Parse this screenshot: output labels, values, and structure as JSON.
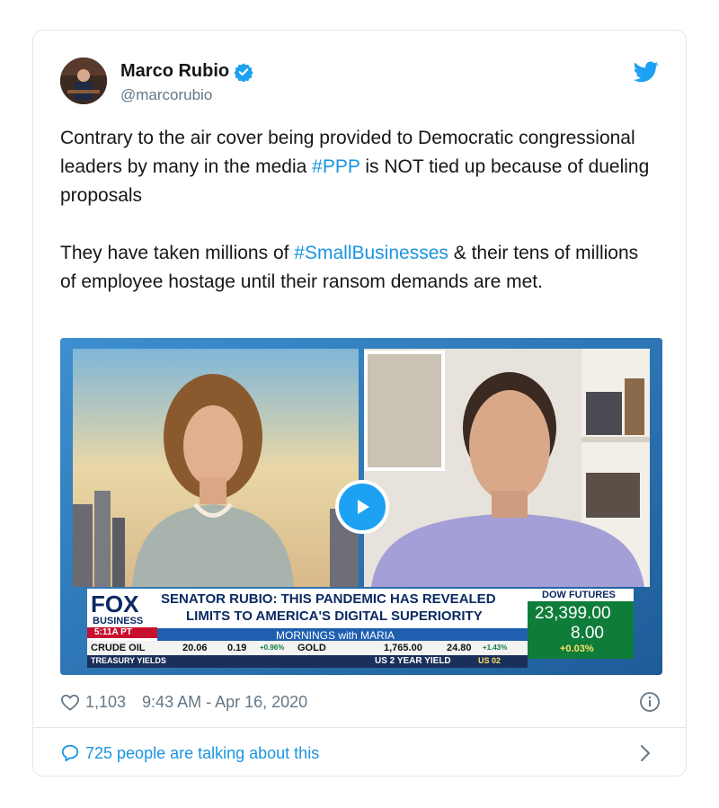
{
  "author": {
    "display_name": "Marco Rubio",
    "handle": "@marcorubio",
    "verified_icon": "verified-badge-icon",
    "platform_icon": "twitter-bird-icon"
  },
  "tweet": {
    "para1_a": "Contrary to the air cover being provided to Democratic congressional leaders by many in the media ",
    "para1_tag": "#PPP",
    "para1_b": " is NOT tied up because of dueling proposals",
    "para2_a": "They have taken millions of ",
    "para2_tag": "#SmallBusinesses",
    "para2_b": " & their tens of millions of employee hostage until their ransom demands are met."
  },
  "video": {
    "network": "FOX",
    "network_sub": "BUSINESS",
    "time_badge": "5:11A PT",
    "headline_line1": "SENATOR RUBIO: THIS PANDEMIC HAS REVEALED",
    "headline_line2": "LIMITS TO AMERICA'S DIGITAL SUPERIORITY",
    "show_name": "MORNINGS with MARIA",
    "dow_label": "DOW FUTURES",
    "dow_value": "23,399.00",
    "dow_change": "8.00",
    "dow_pct": "+0.03%",
    "crude_label": "CRUDE OIL",
    "crude_value": "20.06",
    "crude_change": "0.19",
    "crude_pct": "+0.96%",
    "gold_label": "GOLD",
    "gold_value": "1,765.00",
    "gold_change": "24.80",
    "gold_pct": "+1.43%",
    "treasury_label": "TREASURY YIELDS",
    "us2_label": "US 2 YEAR YIELD",
    "us2_tag": "US 02"
  },
  "meta": {
    "likes": "1,103",
    "timestamp": "9:43 AM - Apr 16, 2020"
  },
  "footer": {
    "talking": "725 people are talking about this"
  },
  "colors": {
    "link": "#1b95e0",
    "text": "#14171a",
    "secondary": "#657786",
    "border": "#e1e8ed"
  }
}
